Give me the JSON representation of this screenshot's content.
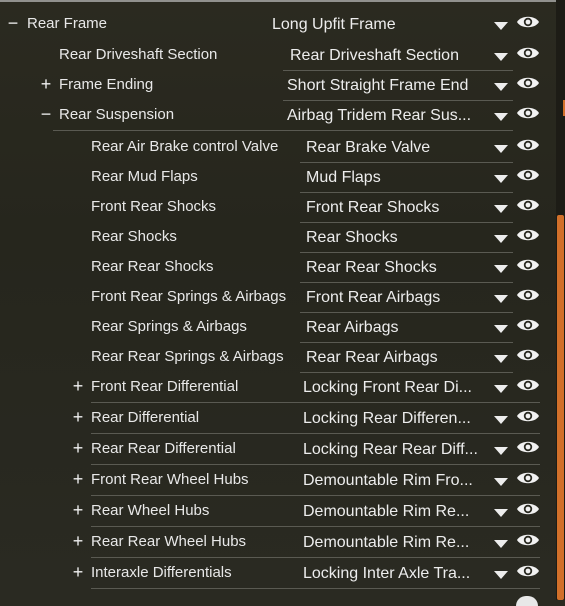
{
  "rows": [
    {
      "id": "rear-frame",
      "label": "Rear Frame",
      "value": "Long Upfit Frame",
      "expander": "−"
    },
    {
      "id": "rear-driveshaft-section",
      "label": "Rear Driveshaft Section",
      "value": "Rear Driveshaft Section",
      "expander": ""
    },
    {
      "id": "frame-ending",
      "label": "Frame Ending",
      "value": "Short Straight Frame End",
      "expander": "+"
    },
    {
      "id": "rear-suspension",
      "label": "Rear Suspension",
      "value": "Airbag Tridem Rear Sus...",
      "expander": "−"
    },
    {
      "id": "rear-air-brake-control-valve",
      "label": "Rear Air Brake control Valve",
      "value": "Rear Brake Valve",
      "expander": ""
    },
    {
      "id": "rear-mud-flaps",
      "label": "Rear Mud Flaps",
      "value": "Mud Flaps",
      "expander": ""
    },
    {
      "id": "front-rear-shocks",
      "label": "Front Rear Shocks",
      "value": "Front Rear Shocks",
      "expander": ""
    },
    {
      "id": "rear-shocks",
      "label": "Rear Shocks",
      "value": "Rear Shocks",
      "expander": ""
    },
    {
      "id": "rear-rear-shocks",
      "label": "Rear Rear Shocks",
      "value": "Rear Rear Shocks",
      "expander": ""
    },
    {
      "id": "front-rear-springs-airbags",
      "label": "Front Rear Springs & Airbags",
      "value": "Front Rear Airbags",
      "expander": ""
    },
    {
      "id": "rear-springs-airbags",
      "label": "Rear Springs & Airbags",
      "value": "Rear Airbags",
      "expander": ""
    },
    {
      "id": "rear-rear-springs-airbags",
      "label": "Rear Rear Springs & Airbags",
      "value": "Rear Rear Airbags",
      "expander": ""
    },
    {
      "id": "front-rear-differential",
      "label": "Front Rear Differential",
      "value": "Locking Front Rear Di...",
      "expander": "+"
    },
    {
      "id": "rear-differential",
      "label": "Rear Differential",
      "value": "Locking Rear Differen...",
      "expander": "+"
    },
    {
      "id": "rear-rear-differential",
      "label": "Rear Rear Differential",
      "value": "Locking Rear Rear Diff...",
      "expander": "+"
    },
    {
      "id": "front-rear-wheel-hubs",
      "label": "Front Rear Wheel Hubs",
      "value": "Demountable Rim Fro...",
      "expander": "+"
    },
    {
      "id": "rear-wheel-hubs",
      "label": "Rear Wheel Hubs",
      "value": "Demountable Rim Re...",
      "expander": "+"
    },
    {
      "id": "rear-rear-wheel-hubs",
      "label": "Rear Rear Wheel Hubs",
      "value": "Demountable Rim Re...",
      "expander": "+"
    },
    {
      "id": "interaxle-differentials",
      "label": "Interaxle Differentials",
      "value": "Locking Inter Axle Tra...",
      "expander": "+"
    }
  ],
  "colors": {
    "accent": "#d2702a",
    "text": "#e8e8e8",
    "separator": "#5a5a52"
  },
  "icons": {
    "collapse": "minus-icon",
    "expand": "plus-icon",
    "dropdown": "caret-down-icon",
    "visibility": "eye-icon"
  }
}
